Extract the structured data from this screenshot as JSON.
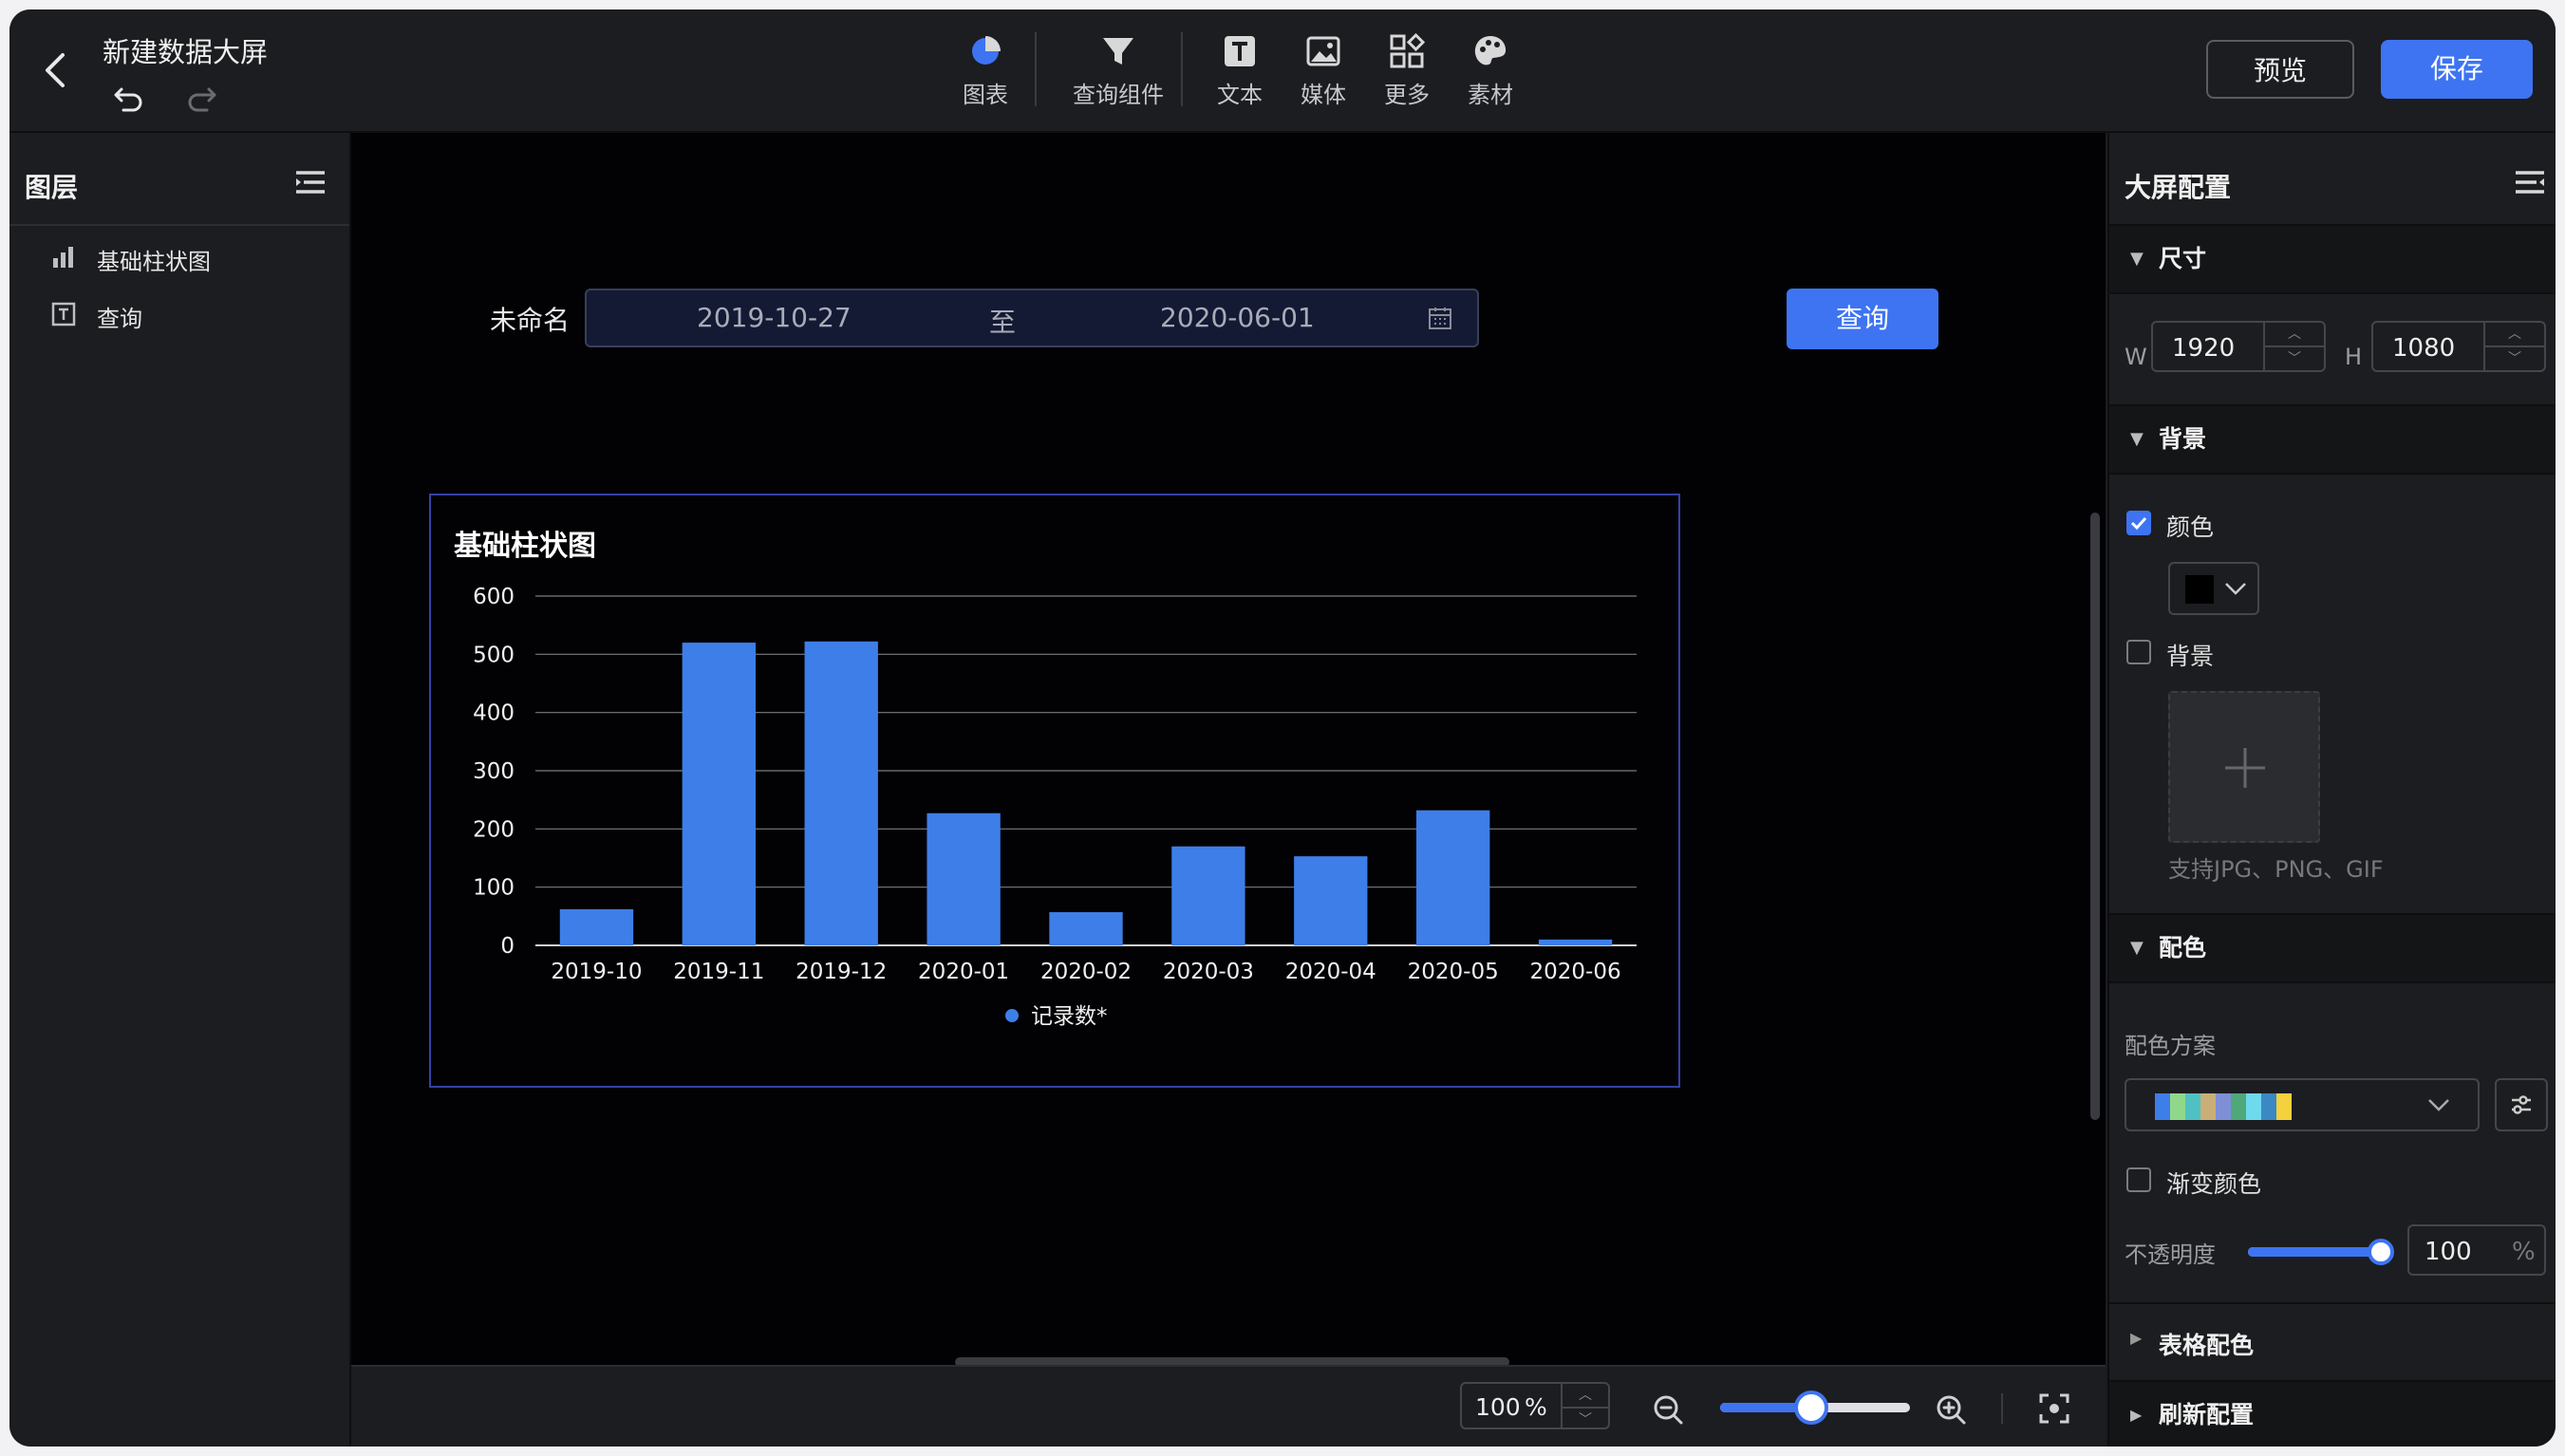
{
  "header": {
    "title": "新建数据大屏",
    "tools": [
      {
        "label": "图表",
        "icon": "pie-chart-icon"
      },
      {
        "label": "查询组件",
        "icon": "filter-icon"
      },
      {
        "label": "文本",
        "icon": "text-icon"
      },
      {
        "label": "媒体",
        "icon": "image-icon"
      },
      {
        "label": "更多",
        "icon": "grid-icon"
      },
      {
        "label": "素材",
        "icon": "palette-icon"
      }
    ],
    "preview_label": "预览",
    "save_label": "保存"
  },
  "layers": {
    "title": "图层",
    "items": [
      {
        "label": "基础柱状图",
        "icon": "bar-chart-icon"
      },
      {
        "label": "查询",
        "icon": "text-box-icon"
      }
    ]
  },
  "query": {
    "label": "未命名",
    "start_date": "2019-10-27",
    "separator": "至",
    "end_date": "2020-06-01",
    "button_label": "查询"
  },
  "chart_widget": {
    "title": "基础柱状图"
  },
  "chart_data": {
    "type": "bar",
    "title": "基础柱状图",
    "categories": [
      "2019-10",
      "2019-11",
      "2019-12",
      "2020-01",
      "2020-02",
      "2020-03",
      "2020-04",
      "2020-05",
      "2020-06"
    ],
    "series": [
      {
        "name": "记录数*",
        "values": [
          62,
          520,
          522,
          227,
          57,
          170,
          153,
          232,
          10
        ]
      }
    ],
    "ylim": [
      0,
      600
    ],
    "yticks": [
      "0",
      "100",
      "200",
      "300",
      "400",
      "500",
      "600"
    ],
    "grid": true,
    "legend": "bottom",
    "color": "#3e7ee8"
  },
  "bottombar": {
    "zoom_value": "100",
    "zoom_unit": "%",
    "zoom_slider_fraction": 0.48
  },
  "config": {
    "title": "大屏配置",
    "size_section": "尺寸",
    "width_label": "W",
    "width_value": "1920",
    "height_label": "H",
    "height_value": "1080",
    "background_section": "背景",
    "color_checkbox_label": "颜色",
    "color_checked": true,
    "bg_color": "#000000",
    "bg_image_checkbox_label": "背景",
    "bg_image_checked": false,
    "upload_hint": "支持JPG、PNG、GIF",
    "palette_section": "配色",
    "palette_scheme_label": "配色方案",
    "palette_colors": [
      "#3e7ee8",
      "#8fd88b",
      "#4fc1c4",
      "#c9ae77",
      "#7f8fd6",
      "#4fa87a",
      "#6fd9ee",
      "#3c88c4",
      "#f5d13d"
    ],
    "gradient_label": "渐变颜色",
    "gradient_checked": false,
    "opacity_label": "不透明度",
    "opacity_value": "100",
    "opacity_unit": "%",
    "opacity_fraction": 1.0,
    "table_color_section": "表格配色",
    "refresh_section": "刷新配置"
  },
  "colors": {
    "accent": "#3e74f2",
    "canvas_bg": "#020205",
    "panel_bg": "#1c1d20"
  }
}
